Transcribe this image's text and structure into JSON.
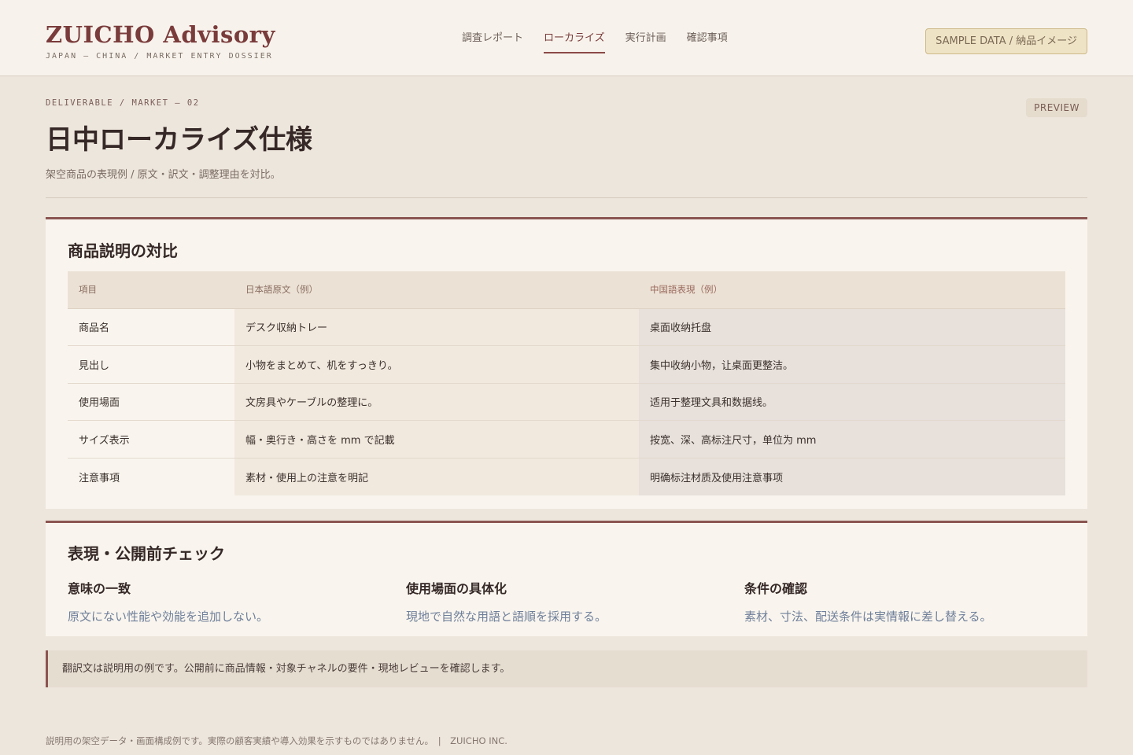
{
  "header": {
    "brand_name": "ZUICHO Advisory",
    "brand_sub": "JAPAN — CHINA / MARKET ENTRY DOSSIER",
    "nav": [
      {
        "label": "調査レポート",
        "active": false
      },
      {
        "label": "ローカライズ",
        "active": true
      },
      {
        "label": "実行計画",
        "active": false
      },
      {
        "label": "確認事項",
        "active": false
      }
    ],
    "sample_badge": "SAMPLE DATA / 納品イメージ"
  },
  "page": {
    "eyebrow": "DELIVERABLE / MARKET — 02",
    "preview_badge": "PREVIEW",
    "title": "日中ローカライズ仕様",
    "subtitle": "架空商品の表現例 / 原文・訳文・調整理由を対比。"
  },
  "compare": {
    "title": "商品説明の対比",
    "columns": [
      "項目",
      "日本語原文（例）",
      "中国語表現（例）"
    ],
    "rows": [
      {
        "item": "商品名",
        "ja": "デスク収納トレー",
        "zh": "桌面收纳托盘"
      },
      {
        "item": "見出し",
        "ja": "小物をまとめて、机をすっきり。",
        "zh": "集中收纳小物，让桌面更整洁。"
      },
      {
        "item": "使用場面",
        "ja": "文房具やケーブルの整理に。",
        "zh": "适用于整理文具和数据线。"
      },
      {
        "item": "サイズ表示",
        "ja": "幅・奥行き・高さを mm で記載",
        "zh": "按宽、深、高标注尺寸，单位为 mm"
      },
      {
        "item": "注意事項",
        "ja": "素材・使用上の注意を明記",
        "zh": "明确标注材质及使用注意事项"
      }
    ]
  },
  "checks": {
    "title": "表現・公開前チェック",
    "items": [
      {
        "title": "意味の一致",
        "text": "原文にない性能や効能を追加しない。"
      },
      {
        "title": "使用場面の具体化",
        "text": "現地で自然な用語と語順を採用する。"
      },
      {
        "title": "条件の確認",
        "text": "素材、寸法、配送条件は実情報に差し替える。"
      }
    ]
  },
  "note": "翻訳文は説明用の例です。公開前に商品情報・対象チャネルの要件・現地レビューを確認します。",
  "footer": "説明用の架空データ・画面構成例です。実際の顧客実績や導入効果を示すものではありません。　|　ZUICHO INC."
}
